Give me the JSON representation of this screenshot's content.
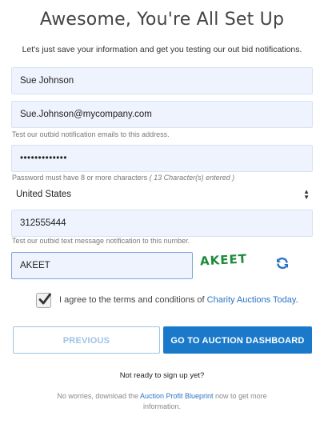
{
  "header": {
    "title": "Awesome, You're All Set Up",
    "subtitle": "Let's just save your information and get you testing our out bid notifications."
  },
  "form": {
    "name_value": "Sue Johnson",
    "email_value": "Sue.Johnson@mycompany.com",
    "email_hint": "Test our outbid notification emails to this address.",
    "password_value": "•••••••••••••",
    "password_hint": "Password must have 8 or more characters",
    "password_hint_count": "( 13 Character(s) entered )",
    "country_value": "United States",
    "phone_value": "312555444",
    "phone_hint": "Test our outbid text message notification to this number.",
    "captcha_value": "AKEET",
    "captcha_image_text": "AKEET",
    "agree_prefix": "I agree to the terms and conditions of",
    "agree_link": "Charity Auctions Today",
    "agree_suffix": "."
  },
  "buttons": {
    "previous_label": "PREVIOUS",
    "go_label": "GO TO AUCTION DASHBOARD"
  },
  "footer": {
    "not_ready": "Not ready to sign up yet?",
    "worries_prefix": "No worries, download the",
    "worries_link": "Auction Profit Blueprint",
    "worries_suffix": "now to get more information."
  },
  "colors": {
    "accent": "#1a7ac9",
    "field_bg": "#eef3fd",
    "link": "#2b74c4",
    "captcha": "#1e8a3a"
  },
  "icons": {
    "refresh": "refresh-icon",
    "check": "check-icon",
    "select_arrows": "updown-arrows-icon"
  }
}
